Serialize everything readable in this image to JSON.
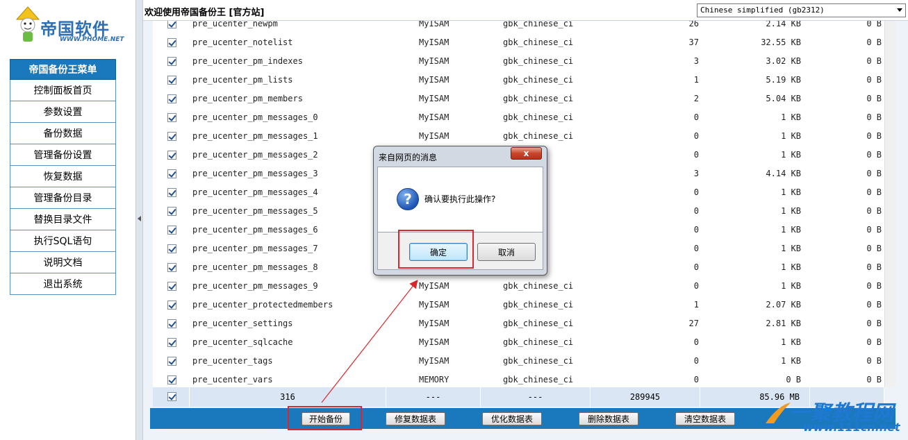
{
  "sidebar": {
    "logo_text": "帝国软件",
    "logo_url": "WWW.PHOME.NET",
    "menu_title": "帝国备份王菜单",
    "items": [
      {
        "label": "控制面板首页"
      },
      {
        "label": "参数设置"
      },
      {
        "label": "备份数据"
      },
      {
        "label": "管理备份设置"
      },
      {
        "label": "恢复数据"
      },
      {
        "label": "管理备份目录"
      },
      {
        "label": "替换目录文件"
      },
      {
        "label": "执行SQL语句"
      },
      {
        "label": "说明文档"
      },
      {
        "label": "退出系统"
      }
    ]
  },
  "header": {
    "title": "欢迎使用帝国备份王 [官方站]",
    "language_selected": "Chinese simplified (gb2312)"
  },
  "table": {
    "rows": [
      {
        "name": "pre_ucenter_newpm",
        "engine": "MyISAM",
        "collation": "gbk_chinese_ci",
        "rows": "26",
        "size": "2.14 KB",
        "overhead": "0 B"
      },
      {
        "name": "pre_ucenter_notelist",
        "engine": "MyISAM",
        "collation": "gbk_chinese_ci",
        "rows": "37",
        "size": "32.55 KB",
        "overhead": "0 B"
      },
      {
        "name": "pre_ucenter_pm_indexes",
        "engine": "MyISAM",
        "collation": "gbk_chinese_ci",
        "rows": "3",
        "size": "3.02 KB",
        "overhead": "0 B"
      },
      {
        "name": "pre_ucenter_pm_lists",
        "engine": "MyISAM",
        "collation": "gbk_chinese_ci",
        "rows": "1",
        "size": "5.19 KB",
        "overhead": "0 B"
      },
      {
        "name": "pre_ucenter_pm_members",
        "engine": "MyISAM",
        "collation": "gbk_chinese_ci",
        "rows": "2",
        "size": "5.04 KB",
        "overhead": "0 B"
      },
      {
        "name": "pre_ucenter_pm_messages_0",
        "engine": "MyISAM",
        "collation": "gbk_chinese_ci",
        "rows": "0",
        "size": "1 KB",
        "overhead": "0 B"
      },
      {
        "name": "pre_ucenter_pm_messages_1",
        "engine": "MyISAM",
        "collation": "gbk_chinese_ci",
        "rows": "0",
        "size": "1 KB",
        "overhead": "0 B"
      },
      {
        "name": "pre_ucenter_pm_messages_2",
        "engine": "",
        "collation": "se_ci",
        "rows": "0",
        "size": "1 KB",
        "overhead": "0 B"
      },
      {
        "name": "pre_ucenter_pm_messages_3",
        "engine": "",
        "collation": "se_ci",
        "rows": "3",
        "size": "4.14 KB",
        "overhead": "0 B"
      },
      {
        "name": "pre_ucenter_pm_messages_4",
        "engine": "",
        "collation": "se_ci",
        "rows": "0",
        "size": "1 KB",
        "overhead": "0 B"
      },
      {
        "name": "pre_ucenter_pm_messages_5",
        "engine": "",
        "collation": "se_ci",
        "rows": "0",
        "size": "1 KB",
        "overhead": "0 B"
      },
      {
        "name": "pre_ucenter_pm_messages_6",
        "engine": "",
        "collation": "se_ci",
        "rows": "0",
        "size": "1 KB",
        "overhead": "0 B"
      },
      {
        "name": "pre_ucenter_pm_messages_7",
        "engine": "",
        "collation": "se_ci",
        "rows": "0",
        "size": "1 KB",
        "overhead": "0 B"
      },
      {
        "name": "pre_ucenter_pm_messages_8",
        "engine": "",
        "collation": "se_ci",
        "rows": "0",
        "size": "1 KB",
        "overhead": "0 B"
      },
      {
        "name": "pre_ucenter_pm_messages_9",
        "engine": "MyISAM",
        "collation": "gbk_chinese_ci",
        "rows": "0",
        "size": "1 KB",
        "overhead": "0 B"
      },
      {
        "name": "pre_ucenter_protectedmembers",
        "engine": "MyISAM",
        "collation": "gbk_chinese_ci",
        "rows": "1",
        "size": "2.07 KB",
        "overhead": "0 B"
      },
      {
        "name": "pre_ucenter_settings",
        "engine": "MyISAM",
        "collation": "gbk_chinese_ci",
        "rows": "27",
        "size": "2.81 KB",
        "overhead": "0 B"
      },
      {
        "name": "pre_ucenter_sqlcache",
        "engine": "MyISAM",
        "collation": "gbk_chinese_ci",
        "rows": "0",
        "size": "1 KB",
        "overhead": "0 B"
      },
      {
        "name": "pre_ucenter_tags",
        "engine": "MyISAM",
        "collation": "gbk_chinese_ci",
        "rows": "0",
        "size": "1 KB",
        "overhead": "0 B"
      },
      {
        "name": "pre_ucenter_vars",
        "engine": "MEMORY",
        "collation": "gbk_chinese_ci",
        "rows": "0",
        "size": "0 B",
        "overhead": "0 B"
      }
    ],
    "totals": {
      "count": "316",
      "engine": "---",
      "collation": "---",
      "rows": "289945",
      "size": "85.96 MB"
    }
  },
  "actions": {
    "start_backup": "开始备份",
    "repair": "修复数据表",
    "optimize": "优化数据表",
    "delete": "删除数据表",
    "empty": "清空数据表"
  },
  "dialog": {
    "title": "来自网页的消息",
    "close": "x",
    "message": "确认要执行此操作?",
    "ok": "确定",
    "cancel": "取消"
  },
  "watermark": {
    "big": "一聚教程网",
    "small": "www.111cn.net"
  }
}
